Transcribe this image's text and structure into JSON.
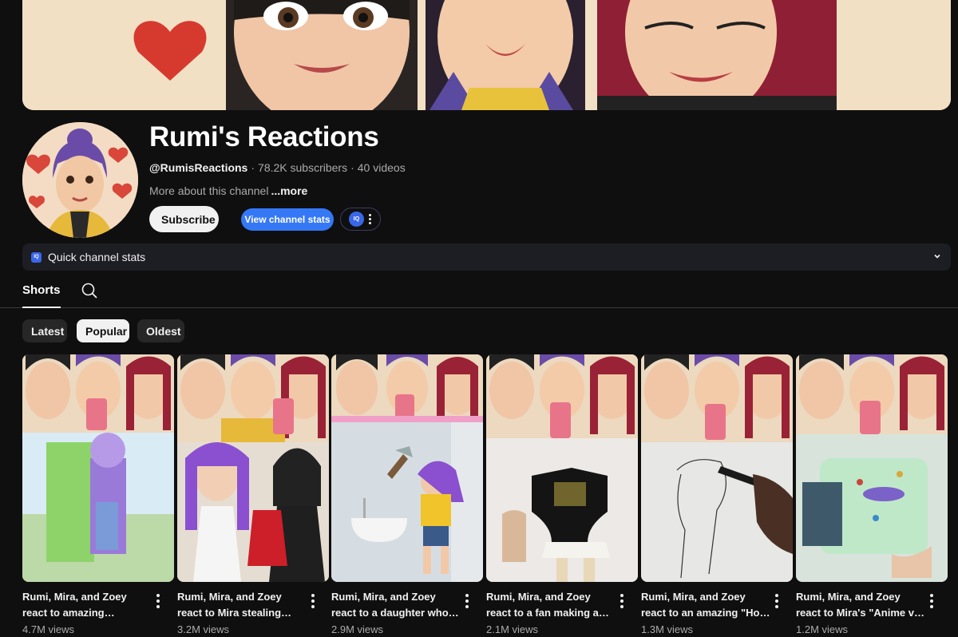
{
  "channel": {
    "name": "Rumi's Reactions",
    "handle": "@RumisReactions",
    "subscribers": "78.2K subscribers",
    "videos": "40 videos",
    "about": "More about this channel",
    "more": "...more",
    "separator": "·"
  },
  "actions": {
    "subscribe": "Subscribe",
    "view_stats": "View channel stats",
    "ext_badge": "IQ"
  },
  "quick_stats": {
    "label": "Quick channel stats",
    "badge": "IQ"
  },
  "tabs": {
    "shorts": "Shorts"
  },
  "chips": [
    "Latest",
    "Popular",
    "Oldest"
  ],
  "shorts": [
    {
      "title": "Rumi, Mira, and Zoey react to amazing disappearing ...",
      "views": "4.7M views"
    },
    {
      "title": "Rumi, Mira, and Zoey react to Mira stealing Rumi's ...",
      "views": "3.2M views"
    },
    {
      "title": "Rumi, Mira, and Zoey react to a daughter who froze h...",
      "views": "2.9M views"
    },
    {
      "title": "Rumi, Mira, and Zoey react to a fan making a Zoey cla...",
      "views": "2.1M views"
    },
    {
      "title": "Rumi, Mira, and Zoey react to an amazing \"How to ...",
      "views": "1.3M views"
    },
    {
      "title": "Rumi, Mira, and Zoey react to Mira's \"Anime vs. ...",
      "views": "1.2M views"
    }
  ],
  "colors": {
    "background": "#0f0f0f",
    "accent": "#3478f6",
    "quick_bar": "#1d1d24"
  }
}
